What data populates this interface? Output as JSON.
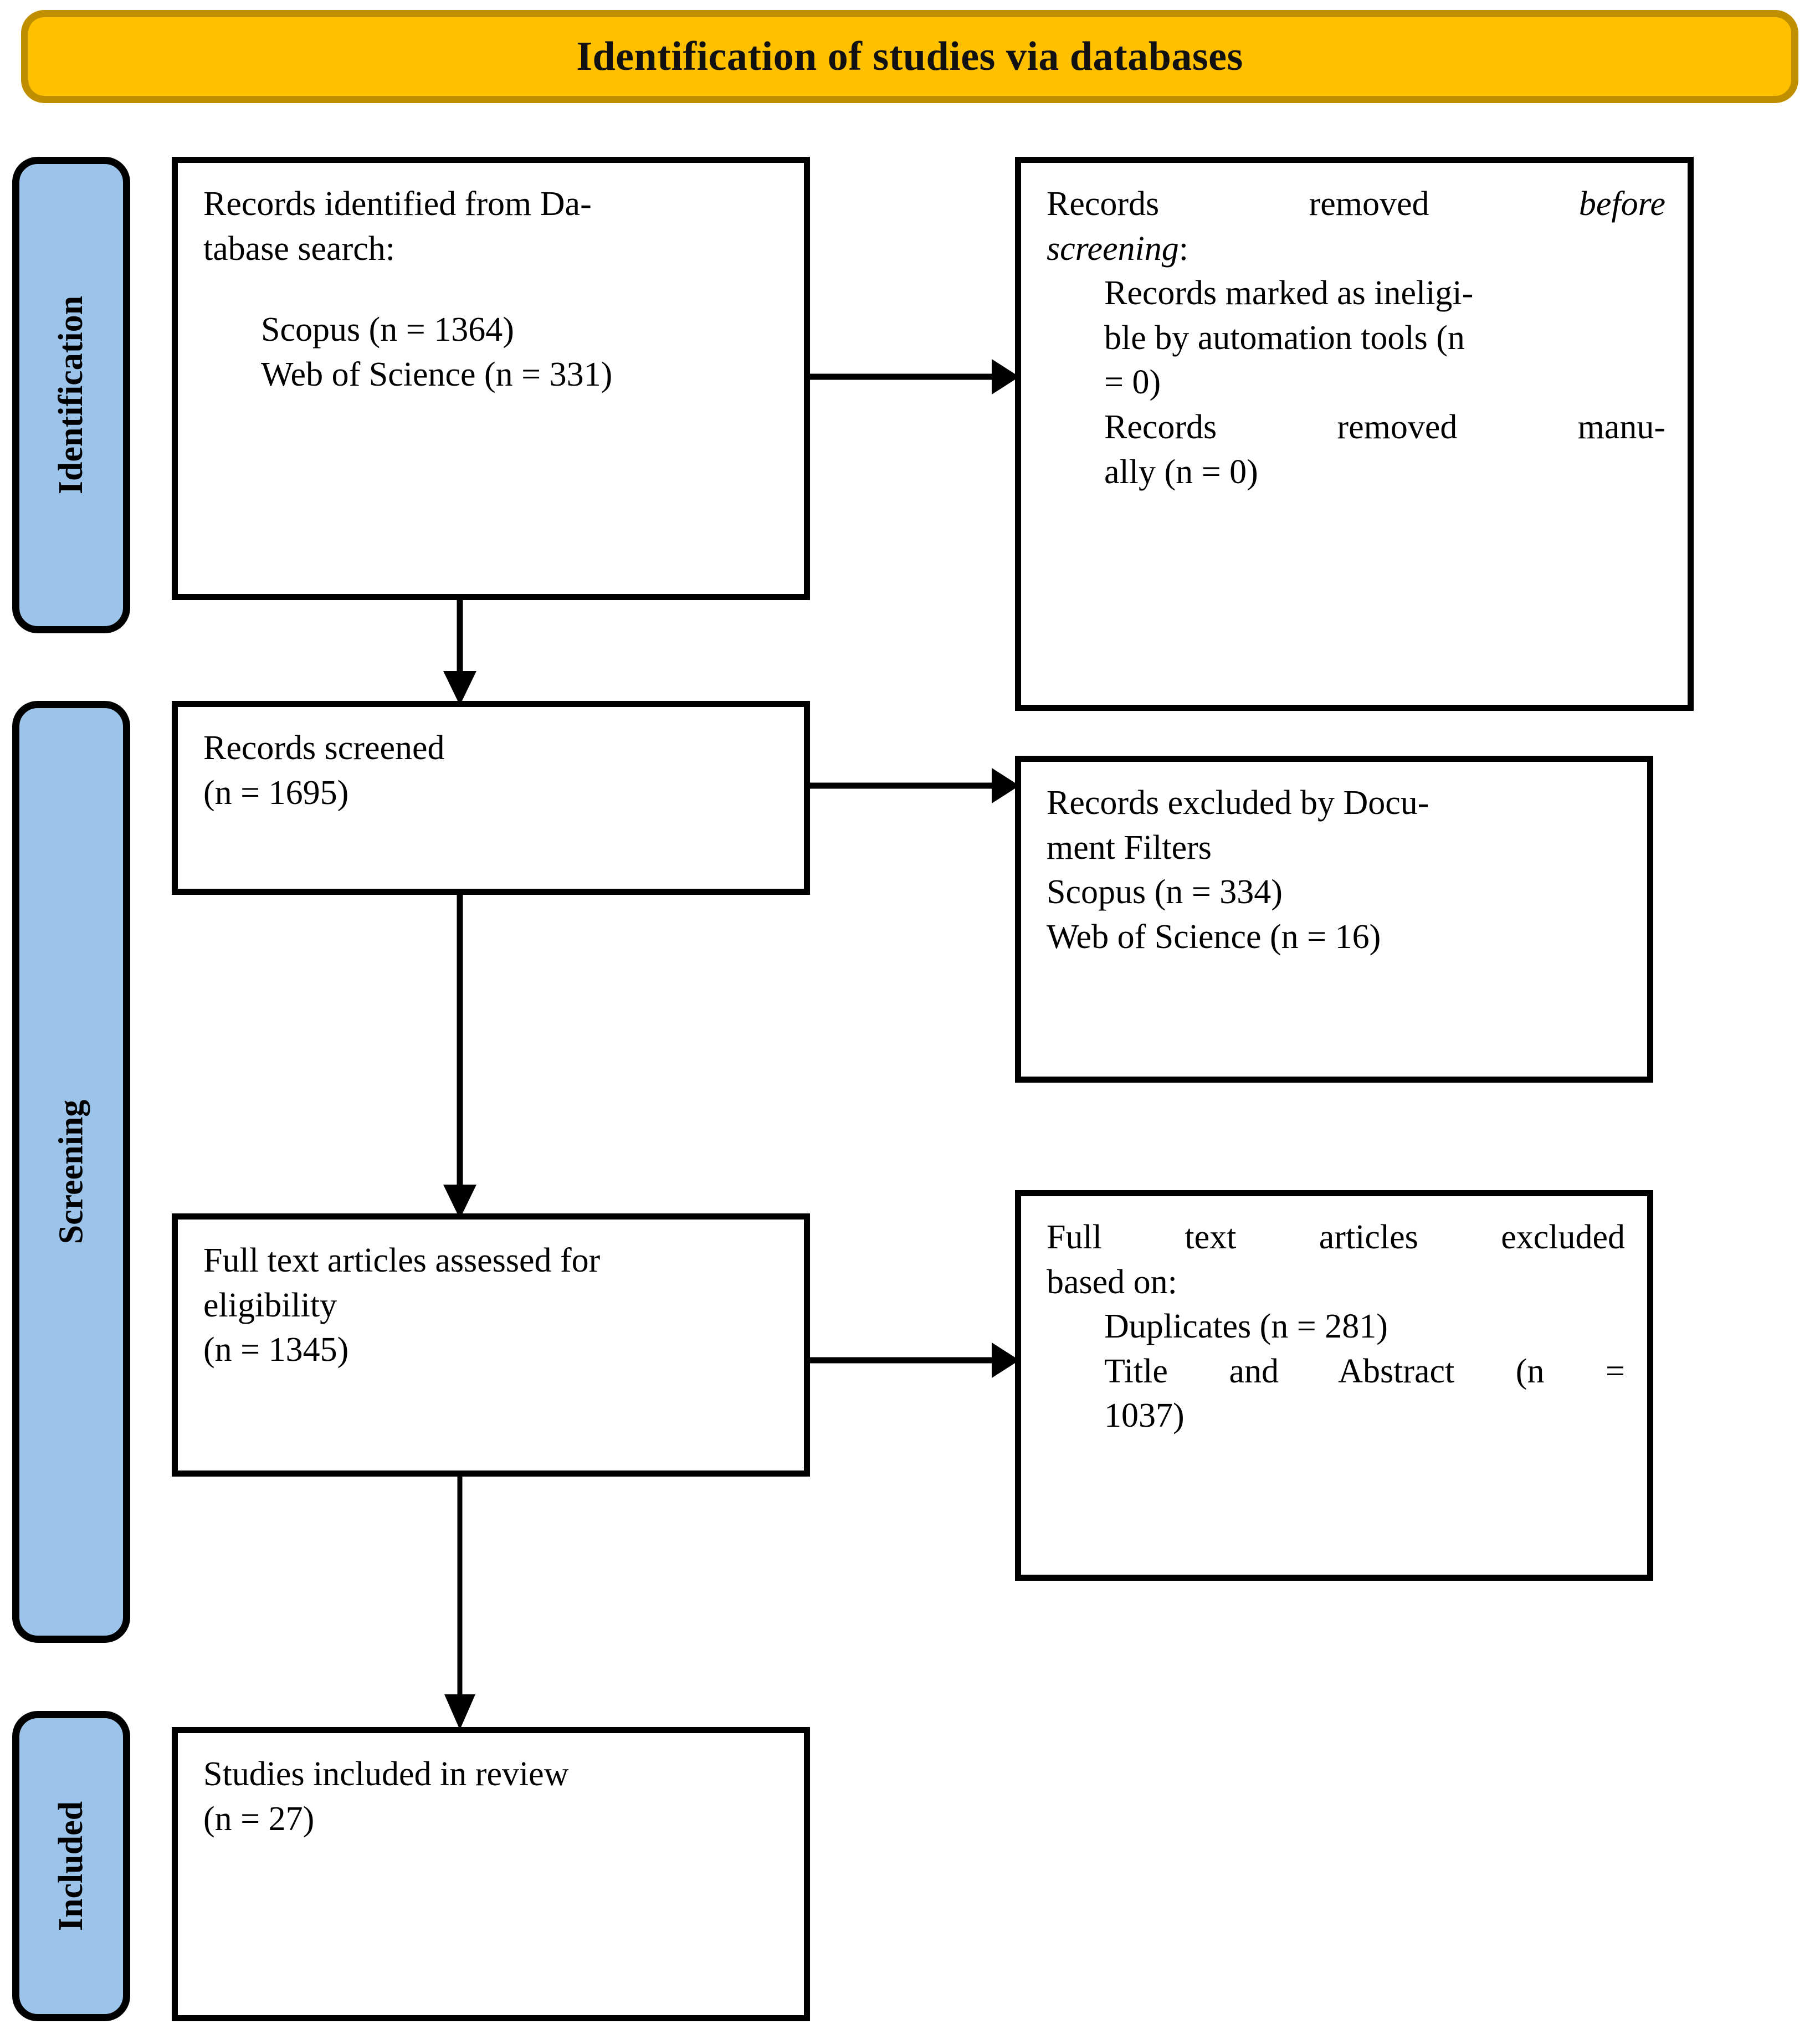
{
  "banner": {
    "title": "Identification of studies via databases",
    "fill_color": "#FFC000",
    "border_color": "#BF8F00"
  },
  "stages": [
    {
      "id": "identification",
      "label": "Identification",
      "fill_color": "#9CC3E9"
    },
    {
      "id": "screening",
      "label": "Screening",
      "fill_color": "#9CC3E9"
    },
    {
      "id": "included",
      "label": "Included",
      "fill_color": "#9CC3E9"
    }
  ],
  "boxes": {
    "identified": {
      "line1": "Records identified from Da-",
      "line2": "tabase search:",
      "item1": "Scopus (n = 1364)",
      "item2": "Web of Science (n = 331)"
    },
    "removed": {
      "line1": "Records removed",
      "line1_em": "before",
      "line2_em": "screening",
      "line2_tail": ":",
      "item1_a": "Records marked as ineligi-",
      "item1_b": "ble by automation tools (n",
      "item1_c": "= 0)",
      "item2_a": "Records removed manu-",
      "item2_b": "ally (n = 0)"
    },
    "screened": {
      "line1": "Records screened",
      "line2": "(n = 1695)"
    },
    "excluded": {
      "line1": "Records excluded by Docu-",
      "line2": "ment Filters",
      "line3": "Scopus (n = 334)",
      "line4": "Web of Science (n = 16)"
    },
    "fulltext": {
      "line1": "Full text articles assessed for",
      "line2": "eligibility",
      "line3": "(n = 1345)"
    },
    "ftexcluded": {
      "line1": "Full text articles excluded",
      "line2": "based on:",
      "item1": "Duplicates (n = 281)",
      "item2_a": "Title and Abstract (n =",
      "item2_b": "1037)"
    },
    "included": {
      "line1": "Studies included in review",
      "line2": "(n = 27)"
    }
  },
  "connectors": [
    {
      "id": "identified-to-removed",
      "direction": "right"
    },
    {
      "id": "identified-to-screened",
      "direction": "down"
    },
    {
      "id": "screened-to-excluded",
      "direction": "right"
    },
    {
      "id": "screened-to-fulltext",
      "direction": "down"
    },
    {
      "id": "fulltext-to-ftexcluded",
      "direction": "right"
    },
    {
      "id": "fulltext-to-included",
      "direction": "down"
    }
  ]
}
